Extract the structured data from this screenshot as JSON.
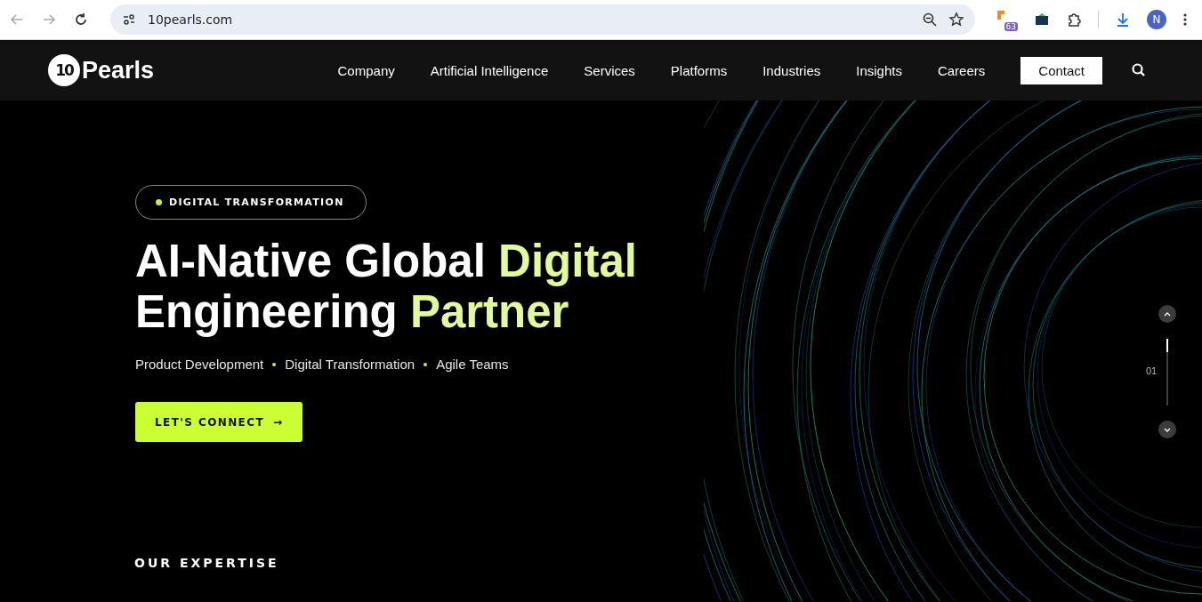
{
  "browser": {
    "url": "10pearls.com",
    "extension_badge": "63",
    "profile_initial": "N"
  },
  "nav": {
    "logo": "Pearls",
    "logo_mark": "10",
    "items": [
      "Company",
      "Artificial Intelligence",
      "Services",
      "Platforms",
      "Industries",
      "Insights",
      "Careers"
    ],
    "contact": "Contact"
  },
  "hero": {
    "tag": "DIGITAL TRANSFORMATION",
    "headline": [
      [
        {
          "text": "AI-Native Global ",
          "accent": false
        },
        {
          "text": "Digital",
          "accent": true
        }
      ],
      [
        {
          "text": "Engineering ",
          "accent": false
        },
        {
          "text": "Partner",
          "accent": true
        }
      ]
    ],
    "services": [
      "Product Development",
      "Digital Transformation",
      "Agile Teams"
    ],
    "cta": "LET'S CONNECT",
    "cta_arrow": "→"
  },
  "slider": {
    "current": "01",
    "level": 0.2
  },
  "section_heading": "OUR EXPERTISE"
}
